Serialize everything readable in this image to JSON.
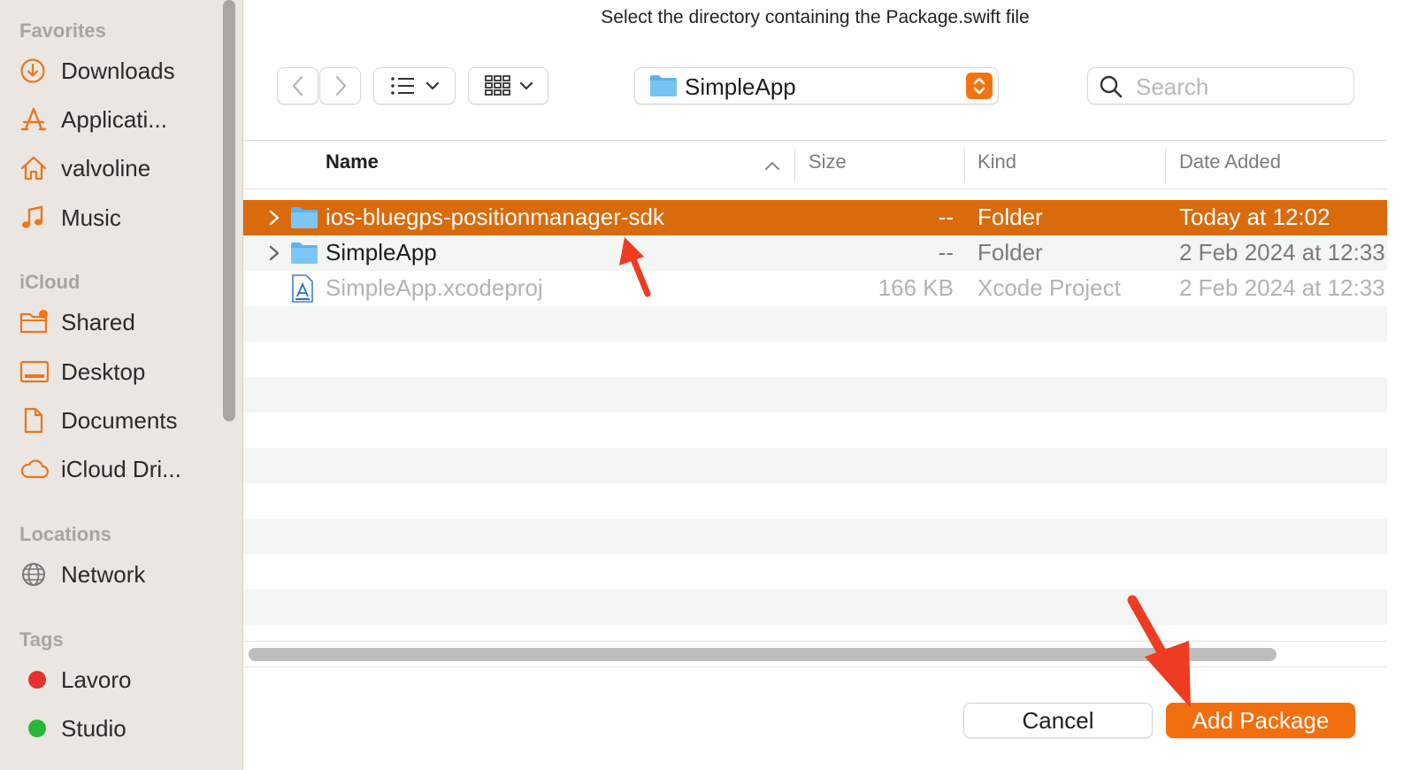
{
  "dialog_title": "Select the directory containing the Package.swift file",
  "sidebar": {
    "sections": [
      {
        "label": "Favorites",
        "items": [
          {
            "label": "Downloads",
            "icon": "download-icon"
          },
          {
            "label": "Applicati...",
            "icon": "applications-icon"
          },
          {
            "label": "valvoline",
            "icon": "home-icon"
          },
          {
            "label": "Music",
            "icon": "music-icon"
          }
        ]
      },
      {
        "label": "iCloud",
        "items": [
          {
            "label": "Shared",
            "icon": "shared-folder-icon"
          },
          {
            "label": "Desktop",
            "icon": "desktop-icon"
          },
          {
            "label": "Documents",
            "icon": "document-icon"
          },
          {
            "label": "iCloud Dri...",
            "icon": "cloud-icon"
          }
        ]
      },
      {
        "label": "Locations",
        "items": [
          {
            "label": "Network",
            "icon": "globe-icon"
          }
        ]
      },
      {
        "label": "Tags",
        "items": [
          {
            "label": "Lavoro",
            "color": "#e6302b"
          },
          {
            "label": "Studio",
            "color": "#27b73b"
          }
        ]
      }
    ]
  },
  "toolbar": {
    "path_label": "SimpleApp",
    "search_placeholder": "Search"
  },
  "columns": {
    "name": "Name",
    "size": "Size",
    "kind": "Kind",
    "date": "Date Added"
  },
  "rows": [
    {
      "name": "ios-bluegps-positionmanager-sdk",
      "size": "--",
      "kind": "Folder",
      "date": "Today at 12:02",
      "selected": true
    },
    {
      "name": "SimpleApp",
      "size": "--",
      "kind": "Folder",
      "date": "2 Feb 2024 at 12:33"
    },
    {
      "name": "SimpleApp.xcodeproj",
      "size": "166 KB",
      "kind": "Xcode Project",
      "date": "2 Feb 2024 at 12:33",
      "disabled": true
    }
  ],
  "buttons": {
    "cancel": "Cancel",
    "add": "Add Package"
  },
  "colors": {
    "accent": "#f26f10",
    "selection": "#d96b0c",
    "annotation_arrow": "#ee3c23"
  }
}
